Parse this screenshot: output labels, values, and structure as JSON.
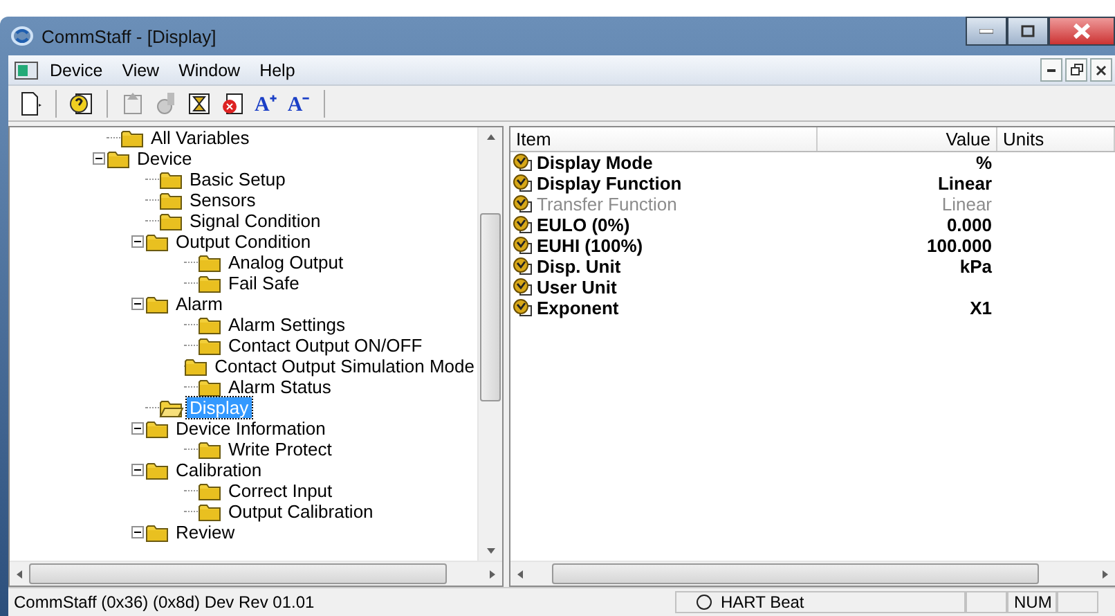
{
  "window": {
    "title": "CommStaff - [Display]"
  },
  "menu": [
    "Device",
    "View",
    "Window",
    "Help"
  ],
  "toolbar": {
    "font_buttons": [
      "A⁺",
      "A⁻"
    ]
  },
  "tree": [
    {
      "label": "All Variables",
      "selected": false
    },
    {
      "label": "Device",
      "selected": false,
      "expanded": true,
      "children": [
        {
          "label": "Basic Setup",
          "selected": false
        },
        {
          "label": "Sensors",
          "selected": false
        },
        {
          "label": "Signal Condition",
          "selected": false
        },
        {
          "label": "Output Condition",
          "selected": false,
          "expanded": true,
          "children": [
            {
              "label": "Analog Output",
              "selected": false
            },
            {
              "label": "Fail Safe",
              "selected": false
            }
          ]
        },
        {
          "label": "Alarm",
          "selected": false,
          "expanded": true,
          "children": [
            {
              "label": "Alarm Settings",
              "selected": false
            },
            {
              "label": "Contact Output ON/OFF",
              "selected": false
            },
            {
              "label": "Contact Output Simulation Mode",
              "selected": false
            },
            {
              "label": "Alarm Status",
              "selected": false
            }
          ]
        },
        {
          "label": "Display",
          "selected": true
        },
        {
          "label": "Device Information",
          "selected": false,
          "expanded": true,
          "children": [
            {
              "label": "Write Protect",
              "selected": false
            }
          ]
        },
        {
          "label": "Calibration",
          "selected": false,
          "expanded": true,
          "children": [
            {
              "label": "Correct Input",
              "selected": false
            },
            {
              "label": "Output Calibration",
              "selected": false
            }
          ]
        },
        {
          "label": "Review",
          "selected": false,
          "expanded": true
        }
      ]
    }
  ],
  "table": {
    "columns": [
      "Item",
      "Value",
      "Units"
    ],
    "rows": [
      {
        "item": "Display Mode",
        "value": "%",
        "disabled": false
      },
      {
        "item": "Display Function",
        "value": "Linear",
        "disabled": false
      },
      {
        "item": "Transfer Function",
        "value": "Linear",
        "disabled": true
      },
      {
        "item": "EULO (0%)",
        "value": "0.000",
        "disabled": false
      },
      {
        "item": "EUHI (100%)",
        "value": "100.000",
        "disabled": false
      },
      {
        "item": "Disp. Unit",
        "value": "kPa",
        "disabled": false
      },
      {
        "item": "User Unit",
        "disabled": false
      },
      {
        "item": "Exponent",
        "value": "X1",
        "disabled": false
      }
    ]
  },
  "status_bar": {
    "info": "CommStaff  (0x36)  (0x8d) Dev Rev 01.01",
    "beat": "HART Beat",
    "num": "NUM"
  }
}
